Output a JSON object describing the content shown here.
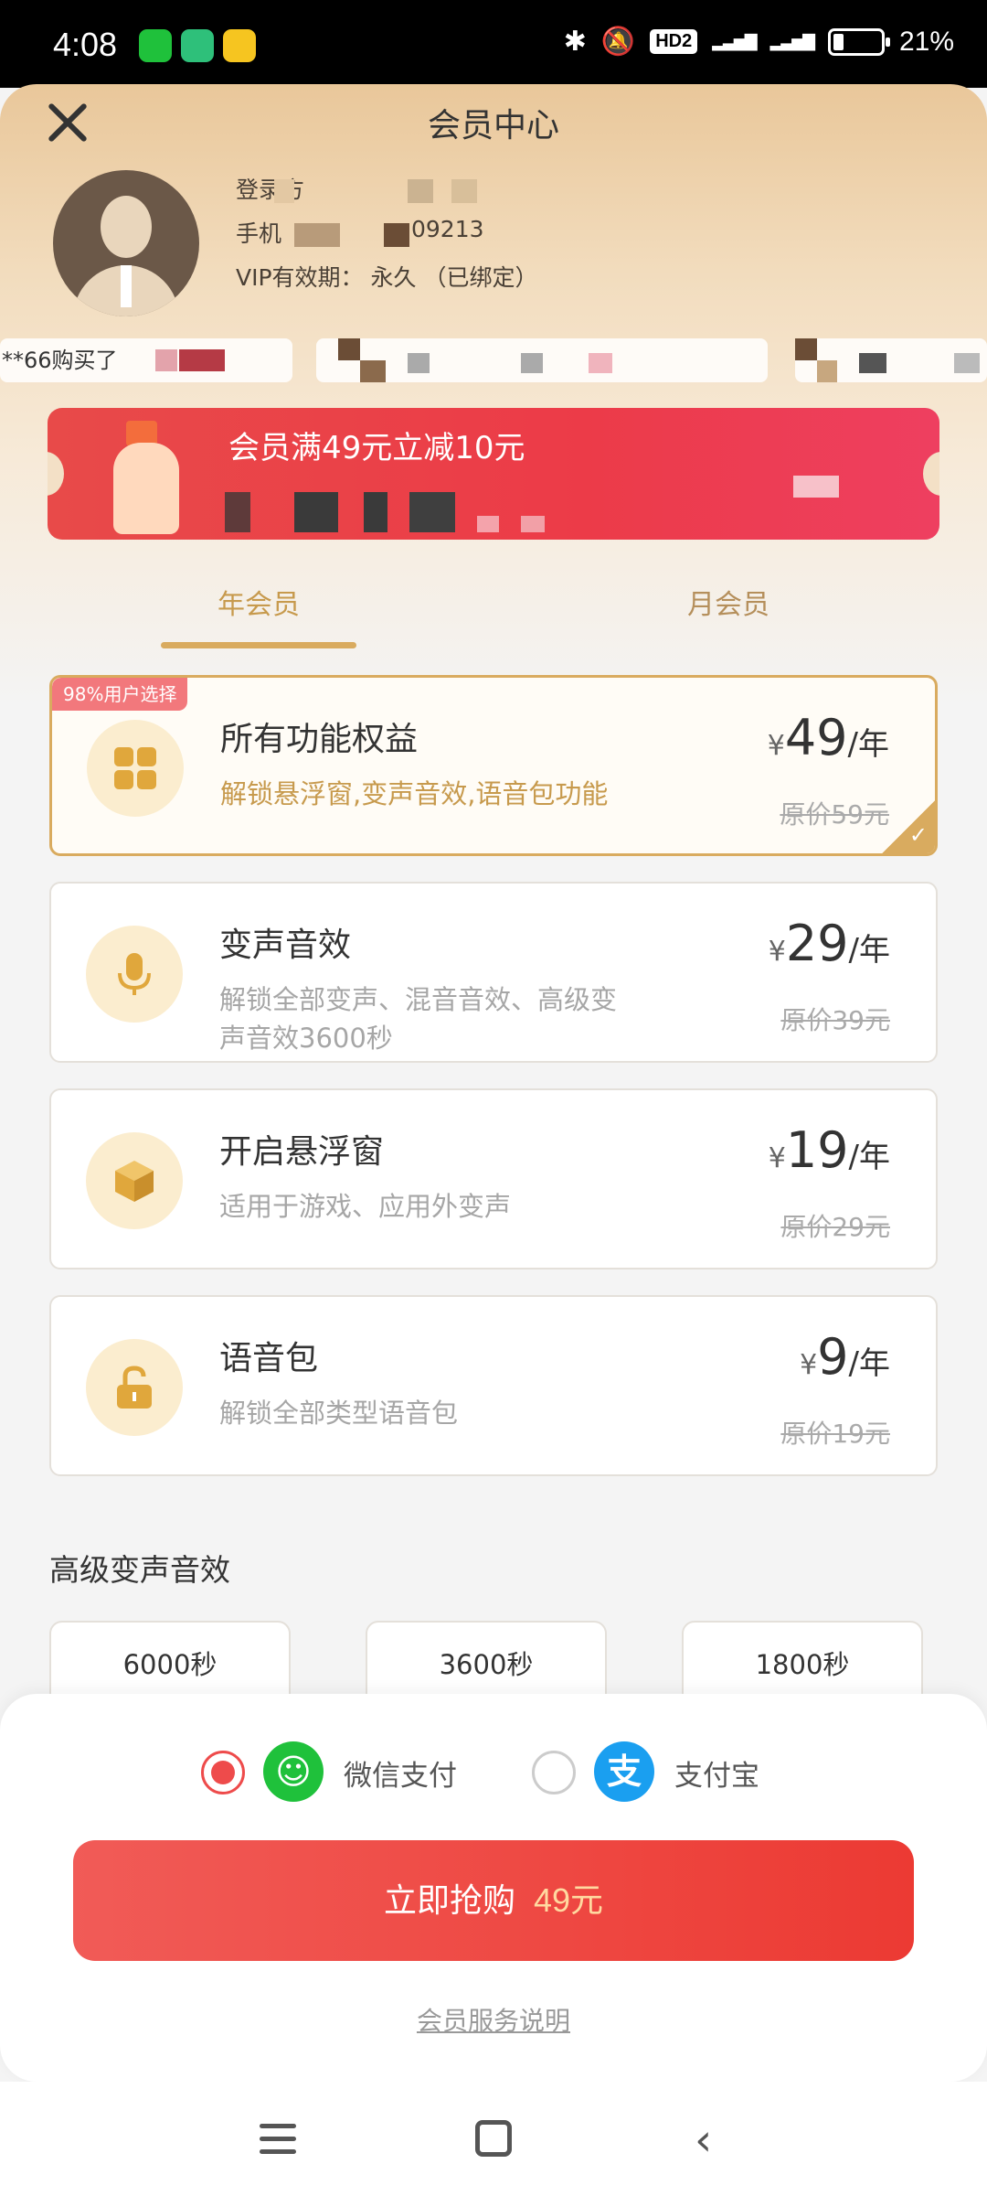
{
  "status_bar": {
    "time": "4:08",
    "battery": "21%",
    "battery_level": 0.21
  },
  "header": {
    "title": "会员中心"
  },
  "user": {
    "login_label": "登录方",
    "phone_label": "手机",
    "phone_tail": "09213",
    "vip_label": "VIP有效期：",
    "vip_value": "永久",
    "vip_status": "（已绑定）"
  },
  "ticker": {
    "first": "**66购买了"
  },
  "promo": {
    "title": "会员满49元立减10元"
  },
  "tabs": [
    {
      "label": "年会员",
      "active": true
    },
    {
      "label": "月会员",
      "active": false
    }
  ],
  "plans": [
    {
      "badge": "98%用户选择",
      "name": "所有功能权益",
      "desc": "解锁悬浮窗,变声音效,语音包功能",
      "currency": "¥",
      "price": "49",
      "unit": "/年",
      "original": "原价59元",
      "selected": true,
      "icon": "grid-icon"
    },
    {
      "name": "变声音效",
      "desc": "解锁全部变声、混音音效、高级变声音效3600秒",
      "currency": "¥",
      "price": "29",
      "unit": "/年",
      "original": "原价39元",
      "selected": false,
      "icon": "microphone-icon"
    },
    {
      "name": "开启悬浮窗",
      "desc": "适用于游戏、应用外变声",
      "currency": "¥",
      "price": "19",
      "unit": "/年",
      "original": "原价29元",
      "selected": false,
      "icon": "cube-icon"
    },
    {
      "name": "语音包",
      "desc": "解锁全部类型语音包",
      "currency": "¥",
      "price": "9",
      "unit": "/年",
      "original": "原价19元",
      "selected": false,
      "icon": "unlock-icon"
    }
  ],
  "advanced": {
    "title": "高级变声音效",
    "options": [
      "6000秒",
      "3600秒",
      "1800秒"
    ]
  },
  "payment": {
    "wechat": "微信支付",
    "alipay": "支付宝",
    "wechat_logo": "☺",
    "alipay_logo": "支",
    "selected": "wechat",
    "buy_label": "立即抢购",
    "buy_amount": "49元",
    "service_link": "会员服务说明"
  },
  "colors": {
    "accent_gold": "#d9ab5f",
    "accent_red": "#ee3f3f"
  }
}
